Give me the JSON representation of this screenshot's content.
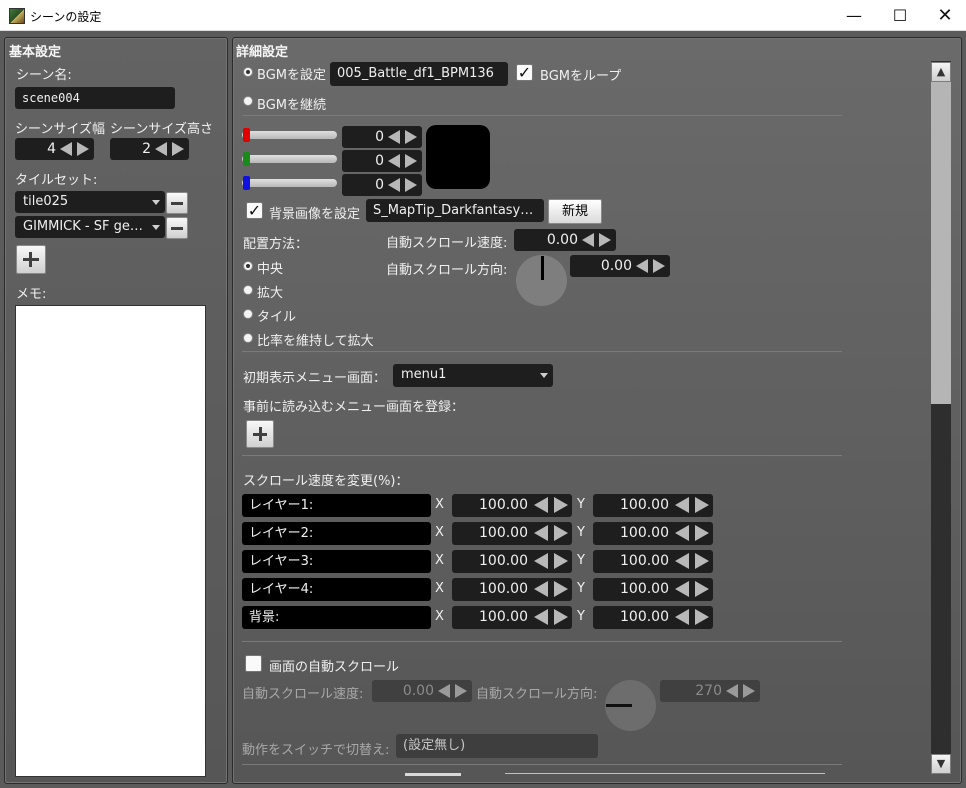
{
  "window": {
    "title": "シーンの設定",
    "min_glyph": "—",
    "max_glyph": "☐",
    "close_glyph": "✕"
  },
  "left": {
    "header": "基本設定",
    "scene_name_label": "シーン名:",
    "scene_name_value": "scene004",
    "size_width_label": "シーンサイズ幅",
    "size_height_label": "シーンサイズ高さ",
    "size_width_value": "4",
    "size_height_value": "2",
    "tileset_label": "タイルセット:",
    "tilesets": [
      "tile025",
      "GIMMICK - SF ge…"
    ],
    "memo_label": "メモ:",
    "memo_value": ""
  },
  "right": {
    "header": "詳細設定",
    "bgm": {
      "set_label": "BGMを設定",
      "set_selected": true,
      "file": "005_Battle_df1_BPM136",
      "loop_label": "BGMをループ",
      "loop_checked": true,
      "continue_label": "BGMを継続",
      "continue_selected": false
    },
    "color": {
      "r": "0",
      "g": "0",
      "b": "0",
      "preview_hex": "#000000"
    },
    "bg_image": {
      "enable_label": "背景画像を設定",
      "enabled": true,
      "file": "S_MapTip_Darkfantasy…",
      "new_label": "新規"
    },
    "placement": {
      "label": "配置方法：",
      "options": [
        "中央",
        "拡大",
        "タイル",
        "比率を維持して拡大"
      ],
      "selected_index": 0
    },
    "auto_scroll_speed_label": "自動スクロール速度:",
    "auto_scroll_speed_value": "0.00",
    "auto_scroll_dir_label": "自動スクロール方向:",
    "auto_scroll_dir_value": "0.00",
    "menu": {
      "initial_label": "初期表示メニュー画面：",
      "initial_value": "menu1",
      "preload_label": "事前に読み込むメニュー画面を登録："
    },
    "scroll_rate": {
      "label": "スクロール速度を変更(%)：",
      "x_label": "X",
      "y_label": "Y",
      "layers": [
        {
          "name": "レイヤー1:",
          "x": "100.00",
          "y": "100.00"
        },
        {
          "name": "レイヤー2:",
          "x": "100.00",
          "y": "100.00"
        },
        {
          "name": "レイヤー3:",
          "x": "100.00",
          "y": "100.00"
        },
        {
          "name": "レイヤー4:",
          "x": "100.00",
          "y": "100.00"
        },
        {
          "name": "背景:",
          "x": "100.00",
          "y": "100.00"
        }
      ]
    },
    "screen_auto_scroll": {
      "label": "画面の自動スクロール",
      "checked": false,
      "speed_label": "自動スクロール速度:",
      "speed_value": "0.00",
      "dir_label": "自動スクロール方向:",
      "dir_value": "270"
    },
    "switch": {
      "label": "動作をスイッチで切替え:",
      "value": "(設定無し)"
    }
  },
  "scrollbar": {
    "up_glyph": "▲",
    "down_glyph": "▼"
  },
  "colors": {
    "red": "#e00000",
    "green": "#1a8a1a",
    "blue": "#1010e0"
  }
}
